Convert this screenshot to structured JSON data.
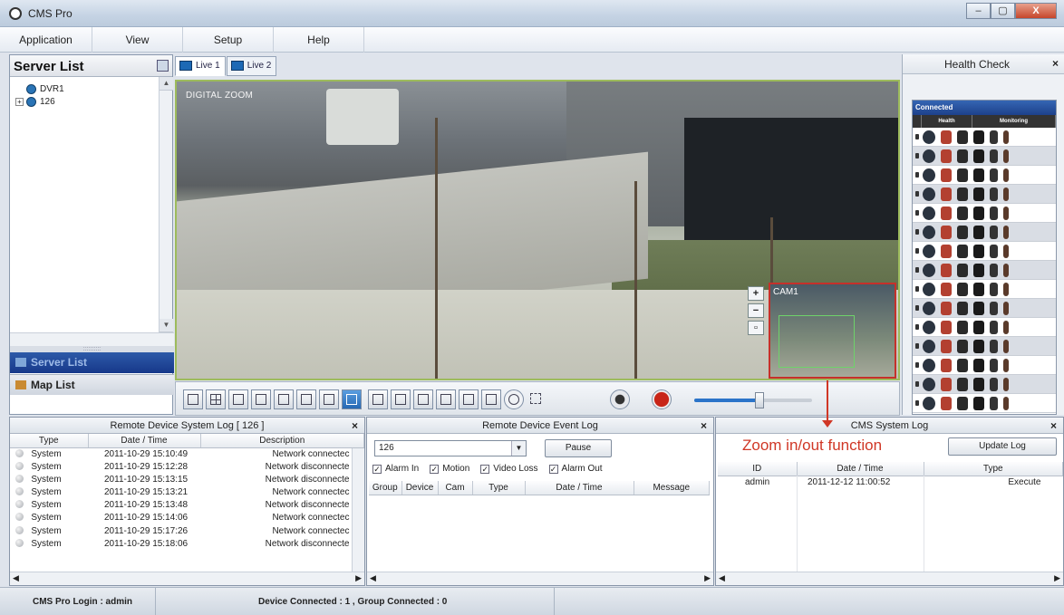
{
  "window": {
    "title": "CMS Pro",
    "minimize": "–",
    "maximize": "▢",
    "close": "X"
  },
  "menu": [
    "Application",
    "View",
    "Setup",
    "Help"
  ],
  "server_panel": {
    "title": "Server List",
    "tree": [
      "DVR1",
      "126"
    ],
    "tabs": {
      "server": "Server List",
      "map": "Map List"
    }
  },
  "live_tabs": [
    "Live 1",
    "Live 2"
  ],
  "video": {
    "overlay_label": "DIGITAL ZOOM",
    "minimap_label": "CAM1",
    "zoom_in": "+",
    "zoom_out": "−",
    "zoom_reset": "▫"
  },
  "toolbar": {
    "slider_value": 0.55
  },
  "health_check": {
    "title": "Health Check",
    "close": "×",
    "box_title": "Connected",
    "columns": [
      "Health",
      "Monitoring"
    ]
  },
  "system_log": {
    "title": "Remote Device System Log  [ 126 ]",
    "close": "×",
    "columns": [
      "Type",
      "Date / Time",
      "Description"
    ],
    "rows": [
      {
        "type": "System",
        "date": "2011-10-29 15:10:49",
        "desc": "Network connectec"
      },
      {
        "type": "System",
        "date": "2011-10-29 15:12:28",
        "desc": "Network disconnecte"
      },
      {
        "type": "System",
        "date": "2011-10-29 15:13:15",
        "desc": "Network disconnecte"
      },
      {
        "type": "System",
        "date": "2011-10-29 15:13:21",
        "desc": "Network connectec"
      },
      {
        "type": "System",
        "date": "2011-10-29 15:13:48",
        "desc": "Network disconnecte"
      },
      {
        "type": "System",
        "date": "2011-10-29 15:14:06",
        "desc": "Network connectec"
      },
      {
        "type": "System",
        "date": "2011-10-29 15:17:26",
        "desc": "Network connectec"
      },
      {
        "type": "System",
        "date": "2011-10-29 15:18:06",
        "desc": "Network disconnecte"
      }
    ]
  },
  "event_log": {
    "title": "Remote Device Event Log",
    "close": "×",
    "device_select": "126",
    "pause_label": "Pause",
    "filters": [
      "Alarm In",
      "Motion",
      "Video Loss",
      "Alarm Out"
    ],
    "columns": [
      "Group",
      "Device",
      "Cam",
      "Type",
      "Date / Time",
      "Message"
    ]
  },
  "cms_log": {
    "title": "CMS System Log",
    "close": "×",
    "update_label": "Update Log",
    "columns": [
      "ID",
      "Date / Time",
      "Type"
    ],
    "rows": [
      {
        "id": "admin",
        "date": "2011-12-12 11:00:52",
        "type": "Execute"
      }
    ]
  },
  "annotation": "Zoom in/out function",
  "status": {
    "login": "CMS Pro Login : admin",
    "connected": "Device Connected : 1 , Group Connected : 0"
  },
  "colors": {
    "accent": "#1f4a9b",
    "annotation": "#d03726",
    "minimap_border": "#c6302a"
  }
}
